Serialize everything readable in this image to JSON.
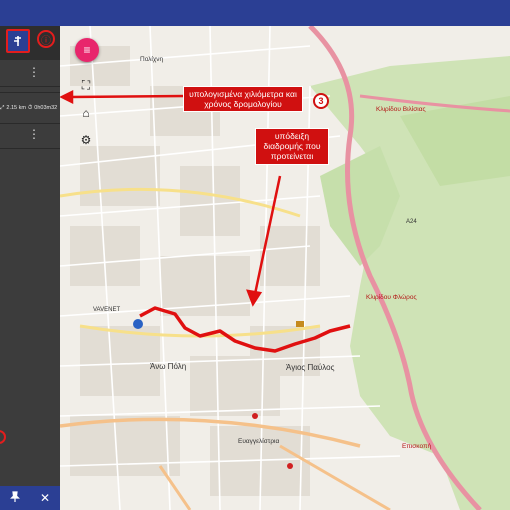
{
  "sidebar": {
    "route_icon": "routing-icon",
    "info_mark": "ⓘ",
    "distance": "2.15 km",
    "duration": "0h03m32",
    "menu_dots": "⋮",
    "pin_icon": "📌",
    "close_icon": "✕"
  },
  "map": {
    "menu_icon": "≡",
    "fullscreen_icon": "⛶",
    "home_icon": "⌂",
    "settings_icon": "⚙",
    "labels": {
      "polichni": "Πολίχνη",
      "ano_poli": "Άνω Πόλη",
      "agios_pavlos": "Άγιος Παύλος",
      "vavenet": "VAVENET",
      "kiliisias": "Κλιρίδου Βιλίσιας",
      "a24": "A24",
      "rehi": "Κλιρίδου Φλώρος",
      "episkopi": "Επισκοπή",
      "evangelistria": "Ευαγγελίστρια"
    }
  },
  "annotations": {
    "callout_distance": "υπολογισμένα χιλιόμετρα και χρόνος δρομολογίου",
    "callout_route": "υπόδειξη διαδρομής που προτείνεται",
    "badge_number": "3"
  }
}
